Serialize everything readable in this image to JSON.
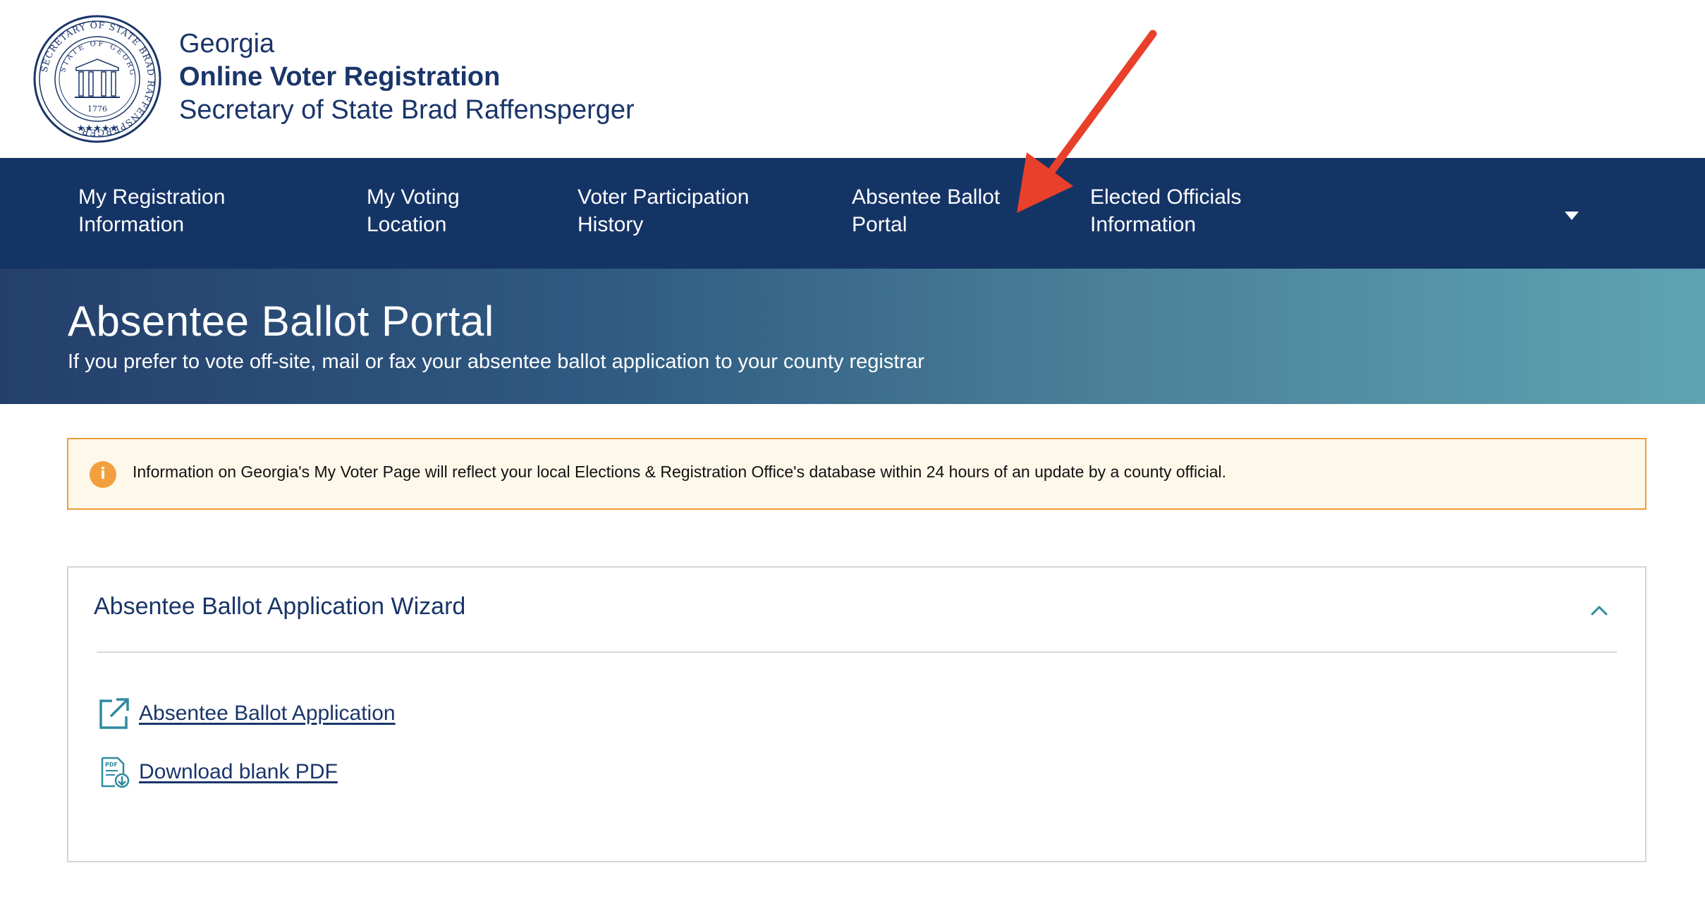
{
  "header": {
    "state": "Georgia",
    "program": "Online Voter Registration",
    "official": "Secretary of State Brad Raffensperger",
    "seal": {
      "outer_text": "SECRETARY OF STATE BRAD RAFFENSPERGER",
      "inner_text": "STATE OF GEORGIA",
      "year": "1776"
    }
  },
  "nav": {
    "items": [
      {
        "line1": "My Registration",
        "line2": "Information"
      },
      {
        "line1": "My Voting",
        "line2": "Location"
      },
      {
        "line1": "Voter Participation",
        "line2": "History"
      },
      {
        "line1": "Absentee Ballot",
        "line2": "Portal"
      },
      {
        "line1": "Elected Officials",
        "line2": "Information"
      }
    ],
    "active_index": 3,
    "more_icon": "caret-down-icon"
  },
  "hero": {
    "title": "Absentee Ballot Portal",
    "subtitle": "If you prefer to vote off-site, mail or fax your absentee ballot application to your county registrar"
  },
  "info_banner": {
    "icon": "info-icon",
    "icon_glyph": "i",
    "text": "Information on Georgia's My Voter Page will reflect your local Elections & Registration Office's database within 24 hours of an update by a county official."
  },
  "wizard": {
    "title": "Absentee Ballot Application Wizard",
    "expanded": true,
    "links": [
      {
        "label": "Absentee Ballot Application",
        "icon": "external-link-icon"
      },
      {
        "label": "Download blank PDF",
        "icon": "pdf-download-icon"
      }
    ]
  },
  "colors": {
    "nav_bg": "#143466",
    "brand_text": "#1a3569",
    "banner_border": "#eb9c3a",
    "banner_bg": "#fdf8ea",
    "annotation_arrow": "#e8402a",
    "accent_teal": "#2f8a9e"
  }
}
